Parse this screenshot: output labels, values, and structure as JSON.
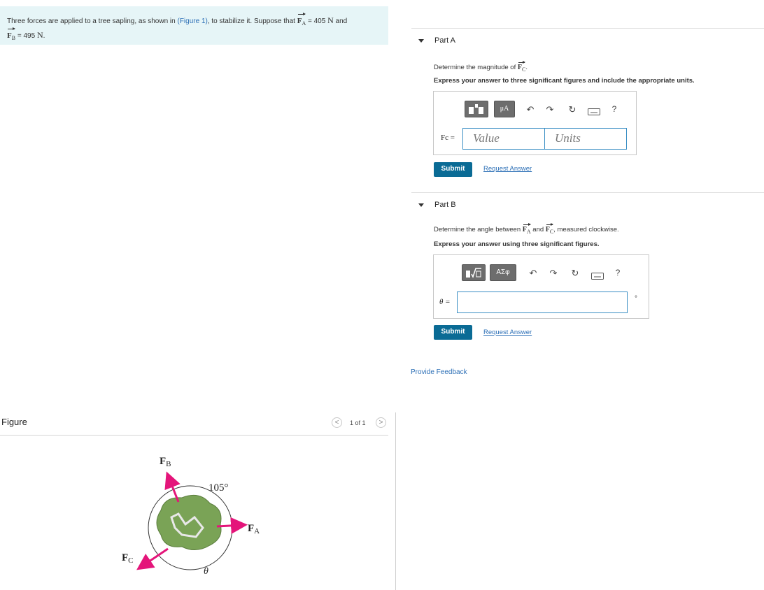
{
  "problem": {
    "text_before_link": "Three forces are applied to a tree sapling, as shown in",
    "figure_link": "(Figure 1)",
    "text_after_link": ", to stabilize it. Suppose that",
    "fa_symbol": "F",
    "fa_sub": "A",
    "fa_value": "= 405",
    "fa_unit": "N",
    "and_word": "and",
    "fb_symbol": "F",
    "fb_sub": "B",
    "fb_value": "= 495",
    "fb_unit": "N",
    "end_period": "."
  },
  "figure": {
    "label": "Figure",
    "pager_prev": "<",
    "pager_text": "1 of 1",
    "pager_next": ">",
    "fb_label": "F",
    "fb_sub": "B",
    "fa_label": "F",
    "fa_sub": "A",
    "fc_label": "F",
    "fc_sub": "C",
    "angle_label": "105°",
    "theta_label": "θ",
    "colors": {
      "arrow": "#e4157a",
      "foliage": "#7aa356",
      "circle": "#333333"
    }
  },
  "part_a": {
    "title": "Part A",
    "question_prefix": "Determine the magnitude of",
    "question_vec": "F",
    "question_sub": "C",
    "question_suffix": ".",
    "instruction": "Express your answer to three significant figures and include the appropriate units.",
    "toolbar": {
      "templates_icon": "templates-icon",
      "mu_label": "μA",
      "undo_icon": "↶",
      "redo_icon": "↷",
      "reset_icon": "↻",
      "keyboard_icon": "keyboard-icon",
      "help_label": "?"
    },
    "var_label": "Fc =",
    "value_placeholder": "Value",
    "units_placeholder": "Units",
    "submit_label": "Submit",
    "request_label": "Request Answer"
  },
  "part_b": {
    "title": "Part B",
    "question_prefix": "Determine the angle between",
    "vec1": "F",
    "vec1_sub": "A",
    "and_word": "and",
    "vec2": "F",
    "vec2_sub": "C",
    "question_suffix": ", measured clockwise.",
    "instruction": "Express your answer using three significant figures.",
    "toolbar": {
      "templates_icon": "templates-icon",
      "greek_label": "ΑΣφ",
      "undo_icon": "↶",
      "redo_icon": "↷",
      "reset_icon": "↻",
      "keyboard_icon": "keyboard-icon",
      "help_label": "?"
    },
    "var_label": "θ =",
    "degree_unit": "°",
    "submit_label": "Submit",
    "request_label": "Request Answer"
  },
  "feedback_label": "Provide Feedback"
}
